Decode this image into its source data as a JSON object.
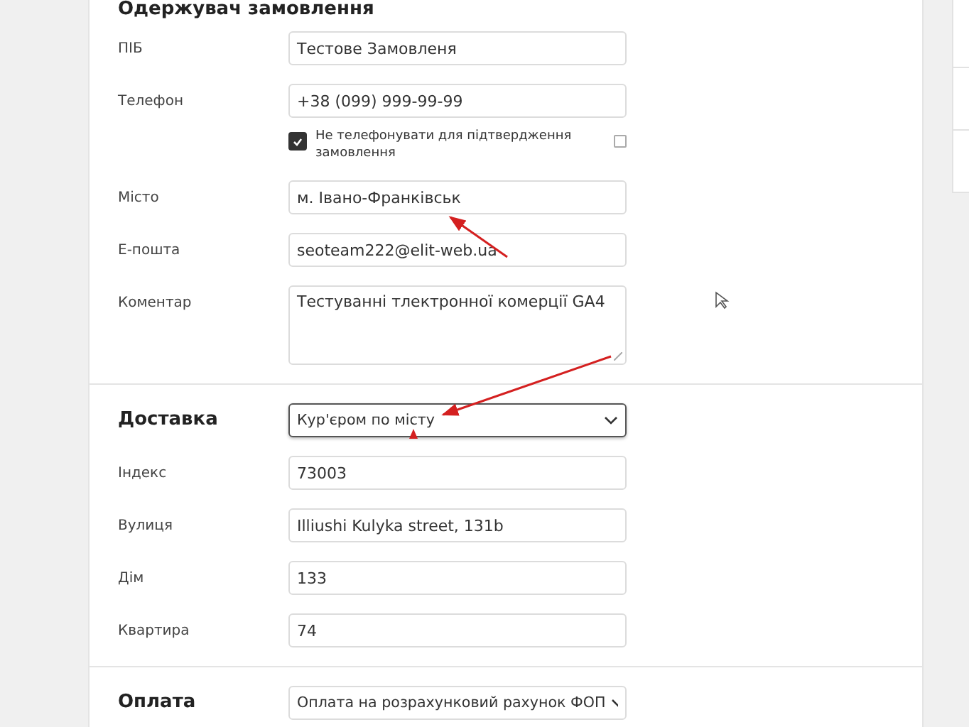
{
  "sections": [
    {
      "title": "Одержувач замовлення",
      "fields": [
        {
          "kind": "input",
          "label": "ПІБ",
          "value": "Тестове Замовленя"
        },
        {
          "kind": "input",
          "label": "Телефон",
          "value": "+38 (099) 999-99-99"
        },
        {
          "kind": "checkbox",
          "label": "Не телефонувати для підтвердження замовлення",
          "checked": true
        },
        {
          "kind": "input",
          "label": "Місто",
          "value": "м. Івано-Франківськ"
        },
        {
          "kind": "input",
          "label": "Е-пошта",
          "value": "seoteam222@elit-web.ua"
        },
        {
          "kind": "textarea",
          "label": "Коментар",
          "value": "Тестуванні тлектронної комерції GA4"
        }
      ]
    },
    {
      "title": "Доставка",
      "select": {
        "value": "Кур'єром по місту",
        "focused": true
      },
      "fields": [
        {
          "kind": "input",
          "label": "Індекс",
          "value": "73003"
        },
        {
          "kind": "input",
          "label": "Вулиця",
          "value": "Illiushi Kulyka street, 131b"
        },
        {
          "kind": "input",
          "label": "Дім",
          "value": "133"
        },
        {
          "kind": "input",
          "label": "Квартира",
          "value": "74"
        }
      ]
    },
    {
      "title": "Оплата",
      "select": {
        "value": "Оплата на розрахунковий рахунок ФОП",
        "focused": false
      }
    }
  ]
}
